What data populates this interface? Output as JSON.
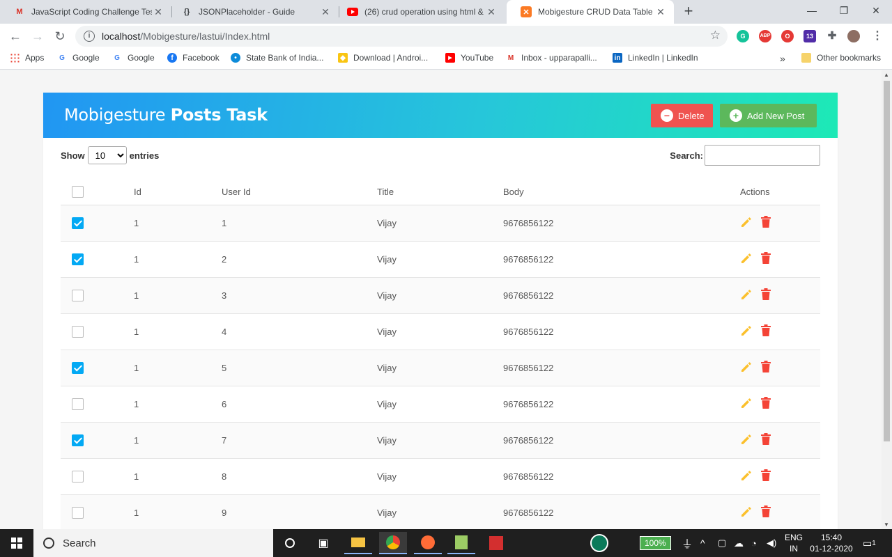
{
  "browser": {
    "tabs": [
      {
        "label": "JavaScript Coding Challenge Test",
        "icon": "gmail-icon",
        "active": false
      },
      {
        "label": "JSONPlaceholder - Guide",
        "icon": "jsonplaceholder-icon",
        "active": false
      },
      {
        "label": "(26) crud operation using html &",
        "icon": "youtube-icon",
        "active": false
      },
      {
        "label": "Mobigesture CRUD Data Table",
        "icon": "xampp-icon",
        "active": true
      }
    ],
    "url_host": "localhost",
    "url_path": "/Mobigesture/lastui/Index.html",
    "extension_badge": "13",
    "bookmarks": [
      {
        "label": "Apps",
        "icon": "apps-grid-icon"
      },
      {
        "label": "Google",
        "icon": "google-icon"
      },
      {
        "label": "Google",
        "icon": "google-icon"
      },
      {
        "label": "Facebook",
        "icon": "facebook-icon"
      },
      {
        "label": "State Bank of India...",
        "icon": "sbi-icon"
      },
      {
        "label": "Download | Androi...",
        "icon": "download-icon"
      },
      {
        "label": "YouTube",
        "icon": "youtube-icon"
      },
      {
        "label": "Inbox - upparapalli...",
        "icon": "gmail-icon"
      },
      {
        "label": "LinkedIn | LinkedIn",
        "icon": "linkedin-icon"
      }
    ],
    "other_bookmarks": "Other bookmarks",
    "more_bookmarks": "»"
  },
  "page": {
    "title_regular": "Mobigesture",
    "title_bold": "Posts Task",
    "delete_label": "Delete",
    "add_label": "Add New Post",
    "show_label": "Show",
    "entries_label": "entries",
    "page_length": "10",
    "search_label": "Search:",
    "search_value": "",
    "columns": {
      "id": "Id",
      "user_id": "User Id",
      "title": "Title",
      "body": "Body",
      "actions": "Actions"
    },
    "rows": [
      {
        "checked": true,
        "id": "1",
        "user_id": "1",
        "title": "Vijay",
        "body": "9676856122"
      },
      {
        "checked": true,
        "id": "1",
        "user_id": "2",
        "title": "Vijay",
        "body": "9676856122"
      },
      {
        "checked": false,
        "id": "1",
        "user_id": "3",
        "title": "Vijay",
        "body": "9676856122"
      },
      {
        "checked": false,
        "id": "1",
        "user_id": "4",
        "title": "Vijay",
        "body": "9676856122"
      },
      {
        "checked": true,
        "id": "1",
        "user_id": "5",
        "title": "Vijay",
        "body": "9676856122"
      },
      {
        "checked": false,
        "id": "1",
        "user_id": "6",
        "title": "Vijay",
        "body": "9676856122"
      },
      {
        "checked": true,
        "id": "1",
        "user_id": "7",
        "title": "Vijay",
        "body": "9676856122"
      },
      {
        "checked": false,
        "id": "1",
        "user_id": "8",
        "title": "Vijay",
        "body": "9676856122"
      },
      {
        "checked": false,
        "id": "1",
        "user_id": "9",
        "title": "Vijay",
        "body": "9676856122"
      }
    ],
    "colors": {
      "header_start": "#2196f3",
      "header_end": "#1de9b6",
      "delete": "#ef5350",
      "add": "#5cb85c",
      "edit": "#fbc02d",
      "trash": "#f44336",
      "checkbox": "#03a9f4"
    }
  },
  "taskbar": {
    "search_placeholder": "Search",
    "battery": "100%",
    "lang_1": "ENG",
    "lang_2": "IN",
    "time": "15:40",
    "date": "01-12-2020",
    "notifications": "1"
  }
}
